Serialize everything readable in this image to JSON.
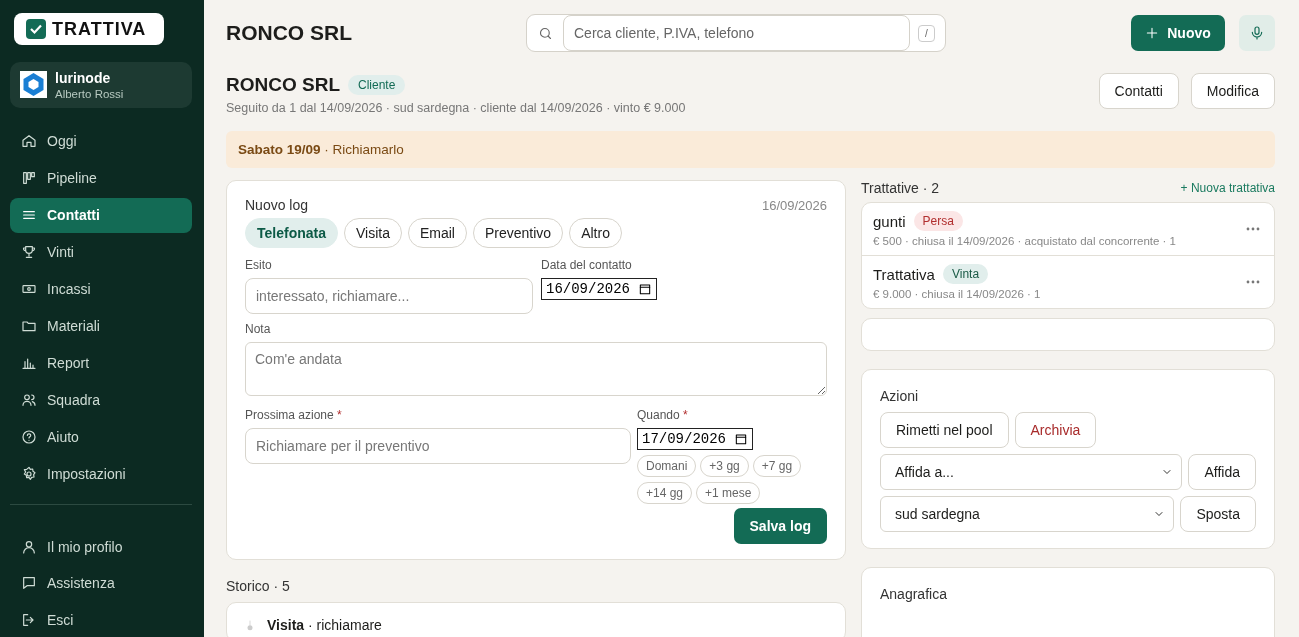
{
  "sidebar": {
    "logo": "TRATTIVA",
    "workspace": {
      "name": "lurinode",
      "user": "Alberto Rossi"
    },
    "nav": [
      {
        "label": "Oggi",
        "selected": false
      },
      {
        "label": "Pipeline",
        "selected": false
      },
      {
        "label": "Contatti",
        "selected": true
      },
      {
        "label": "Vinti",
        "selected": false
      },
      {
        "label": "Incassi",
        "selected": false
      },
      {
        "label": "Materiali",
        "selected": false
      },
      {
        "label": "Report",
        "selected": false
      },
      {
        "label": "Squadra",
        "selected": false
      },
      {
        "label": "Aiuto",
        "selected": false
      },
      {
        "label": "Impostazioni",
        "selected": false
      }
    ],
    "footer": [
      {
        "label": "Il mio profilo"
      },
      {
        "label": "Assistenza"
      },
      {
        "label": "Esci"
      }
    ]
  },
  "header": {
    "title": "RONCO SRL",
    "search": {
      "placeholder": "Cerca cliente, P.IVA, telefono",
      "shortcut": "/"
    },
    "new_button": "Nuovo"
  },
  "client": {
    "name": "RONCO SRL",
    "badge": "Cliente",
    "meta": "Seguito da 1 dal 14/09/2026 · sud sardegna · cliente dal 14/09/2026 · vinto € 9.000",
    "buttons": [
      "Contatti",
      "Modifica"
    ]
  },
  "reminder": "**Sabato 19/09** · Richiamarlo",
  "log": {
    "title": "Nuovo log",
    "date": "16/09/2026",
    "types": [
      {
        "label": "Telefonata",
        "selected": true
      },
      {
        "label": "Visita",
        "selected": false
      },
      {
        "label": "Email",
        "selected": false
      },
      {
        "label": "Preventivo",
        "selected": false
      },
      {
        "label": "Altro",
        "selected": false
      }
    ],
    "esito": {
      "label": "Esito",
      "placeholder": "interessato, richiamare..."
    },
    "contact_date": {
      "label": "Data del contatto",
      "value": "16/09/2026"
    },
    "note": {
      "label": "Nota",
      "placeholder": "Com'e andata"
    },
    "next_action": {
      "label": "Prossima azione",
      "required_mark": "*",
      "placeholder": "Richiamare per il preventivo"
    },
    "when": {
      "label": "Quando",
      "required_mark": "*",
      "value": "17/09/2026"
    },
    "quick_dates": [
      "Domani",
      "+3 gg",
      "+7 gg",
      "+14 gg",
      "+1 mese"
    ],
    "save_button": "Salva log"
  },
  "history": {
    "title": "Storico · 5",
    "entries": [
      {
        "text": "**Visita** · richiamare"
      }
    ]
  },
  "deals": {
    "title": "Trattative · 2",
    "new_link": "+ Nuova trattativa",
    "items": [
      {
        "name": "gunti",
        "status": "Persa",
        "kind": "lost",
        "meta": "€ 500 · chiusa il 14/09/2026 · acquistato dal concorrente · 1"
      },
      {
        "name": "Trattativa",
        "status": "Vinta",
        "kind": "won",
        "meta": "€ 9.000 · chiusa il 14/09/2026 · 1"
      }
    ]
  },
  "actions": {
    "title": "Azioni",
    "buttons": [
      {
        "label": "Rimetti nel pool",
        "kind": "default"
      },
      {
        "label": "Archivia",
        "kind": "danger"
      }
    ],
    "selects": [
      {
        "value": "Affida a...",
        "button": "Affida"
      },
      {
        "value": "sud sardegna",
        "button": "Sposta"
      }
    ]
  },
  "registry": {
    "title": "Anagrafica"
  }
}
